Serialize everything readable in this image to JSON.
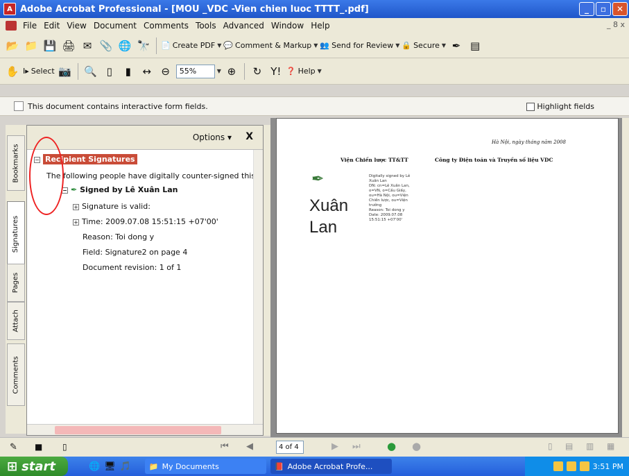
{
  "window": {
    "title": "Adobe Acrobat Professional - [MOU _VDC -Vien chien luoc TTTT_.pdf]"
  },
  "menu": [
    "File",
    "Edit",
    "View",
    "Document",
    "Comments",
    "Tools",
    "Advanced",
    "Window",
    "Help"
  ],
  "menu_right": "_ 8 x",
  "toolbar1": {
    "create_pdf": "Create PDF",
    "comment_markup": "Comment & Markup",
    "send_review": "Send for Review",
    "secure": "Secure"
  },
  "toolbar2": {
    "select": "Select",
    "zoom": "55%",
    "help": "Help"
  },
  "message_bar": {
    "text": "This document contains interactive form fields.",
    "highlight": "Highlight fields"
  },
  "side_tabs": [
    "Bookmarks",
    "Signatures",
    "Pages",
    "Attach",
    "Comments"
  ],
  "panel": {
    "options": "Options",
    "close": "X",
    "title": "Recipient Signatures",
    "intro": "The following people have digitally counter-signed this",
    "signed_by": "Signed by Lê Xuân Lan",
    "valid": "Signature is valid:",
    "time": "Time: 2009.07.08 15:51:15 +07'00'",
    "reason": "Reason: Toi dong y",
    "field": "Field: Signature2 on page 4",
    "revision": "Document revision: 1 of 1"
  },
  "page": {
    "date_line": "Hà Nội, ngày   tháng   năm 2008",
    "left_org": "Viện Chiến lược TT&TT",
    "right_org": "Công ty Điện toán và Truyền số liệu VDC",
    "name_line1": "Xuân",
    "name_line2": "Lan",
    "sig_details": [
      "Digitally signed by Lê",
      "Xuân Lan",
      "DN: cn=Lê Xuân Lan,",
      "o=VN, o=Cấu Giấy,",
      "ou=Hà Nội, ou=Viện",
      "Chiến lược, ou=Viện",
      "trưởng",
      "Reason: Toi dong y",
      "Date: 2009.07.08",
      "15:51:15 +07'00'"
    ]
  },
  "nav": {
    "page": "4 of 4"
  },
  "taskbar": {
    "start": "start",
    "item1": "My Documents",
    "item2": "Adobe Acrobat Profe...",
    "clock": "3:51 PM"
  }
}
